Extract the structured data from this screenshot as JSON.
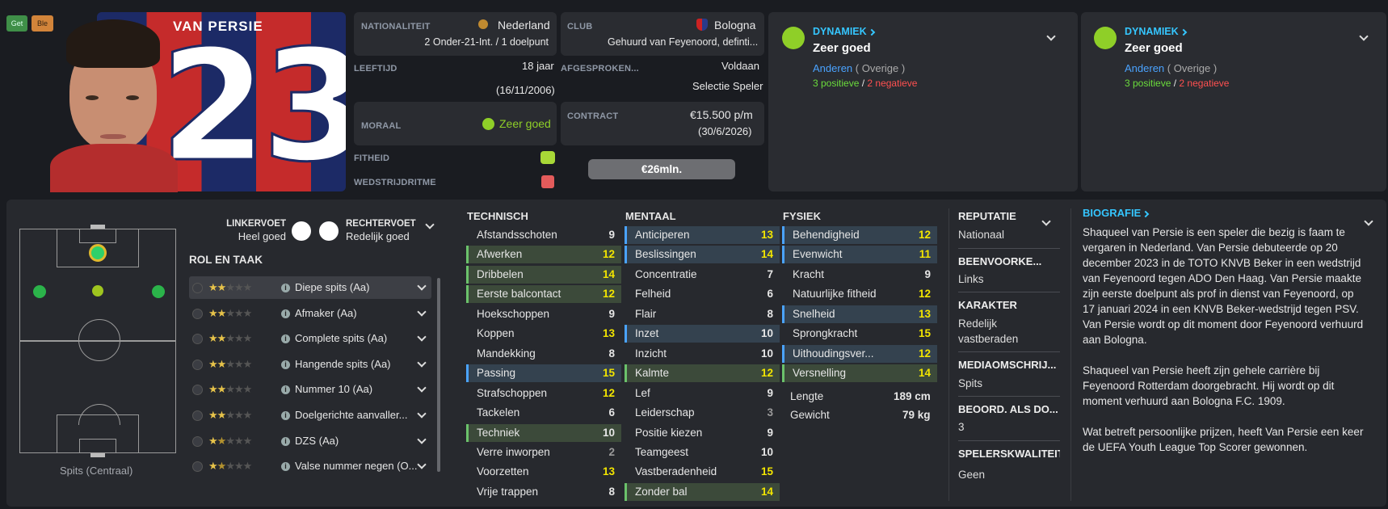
{
  "buttons": {
    "get": "Get",
    "ble": "Ble"
  },
  "player": {
    "name": "VAN PERSIE",
    "number": "23",
    "position": "Spits (Centraal)"
  },
  "info": {
    "nationaliteit_label": "NATIONALITEIT",
    "nationaliteit": "Nederland",
    "caps": "2 Onder-21-Int. / 1 doelpunt",
    "club_label": "CLUB",
    "club": "Bologna",
    "club_sub": "Gehuurd van Feyenoord, definti...",
    "leeftijd_label": "LEEFTIJD",
    "leeftijd": "18 jaar",
    "geboorte": "(16/11/2006)",
    "afgesproken_label": "AFGESPROKEN...",
    "afgesproken": "Voldaan",
    "selectie": "Selectie Speler",
    "moraal_label": "MORAAL",
    "moraal": "Zeer goed",
    "contract_label": "CONTRACT",
    "contract": "€15.500 p/m",
    "contract_end": "(30/6/2026)",
    "fitheid_label": "FITHEID",
    "wedstrijd_label": "WEDSTRIJDRITME",
    "waarde": "€26mln."
  },
  "dyn1": {
    "title": "DYNAMIEK",
    "value": "Zeer goed",
    "group": "Anderen",
    "group_sub": "( Overige )",
    "pos": "3 positieve",
    "sep": "/",
    "neg": "2 negatieve"
  },
  "dyn2": {
    "title": "DYNAMIEK",
    "value": "Zeer goed",
    "group": "Anderen",
    "group_sub": "( Overige )",
    "pos": "3 positieve",
    "sep": "/",
    "neg": "2 negatieve"
  },
  "feet": {
    "left_label": "LINKERVOET",
    "left": "Heel goed",
    "right_label": "RECHTERVOET",
    "right": "Redelijk goed"
  },
  "rol": {
    "title": "ROL EN TAAK",
    "items": [
      {
        "name": "Diepe spits (Aa)",
        "stars": 2
      },
      {
        "name": "Afmaker (Aa)",
        "stars": 2
      },
      {
        "name": "Complete spits (Aa)",
        "stars": 2
      },
      {
        "name": "Hangende spits (Aa)",
        "stars": 2
      },
      {
        "name": "Nummer 10 (Aa)",
        "stars": 2
      },
      {
        "name": "Doelgerichte aanvaller...",
        "stars": 2
      },
      {
        "name": "DZS (Aa)",
        "stars": 1.5
      },
      {
        "name": "Valse nummer negen (O...",
        "stars": 1.5
      }
    ]
  },
  "technisch": {
    "title": "TECHNISCH",
    "rows": [
      {
        "n": "Afstandsschoten",
        "v": "9",
        "h": ""
      },
      {
        "n": "Afwerken",
        "v": "12",
        "h": "g"
      },
      {
        "n": "Dribbelen",
        "v": "14",
        "h": "g"
      },
      {
        "n": "Eerste balcontact",
        "v": "12",
        "h": "g"
      },
      {
        "n": "Hoekschoppen",
        "v": "9",
        "h": ""
      },
      {
        "n": "Koppen",
        "v": "13",
        "h": ""
      },
      {
        "n": "Mandekking",
        "v": "8",
        "h": ""
      },
      {
        "n": "Passing",
        "v": "15",
        "h": "b"
      },
      {
        "n": "Strafschoppen",
        "v": "12",
        "h": ""
      },
      {
        "n": "Tackelen",
        "v": "6",
        "h": ""
      },
      {
        "n": "Techniek",
        "v": "10",
        "h": "g"
      },
      {
        "n": "Verre inworpen",
        "v": "2",
        "h": ""
      },
      {
        "n": "Voorzetten",
        "v": "13",
        "h": ""
      },
      {
        "n": "Vrije trappen",
        "v": "8",
        "h": ""
      }
    ]
  },
  "mentaal": {
    "title": "MENTAAL",
    "rows": [
      {
        "n": "Anticiperen",
        "v": "13",
        "h": "b"
      },
      {
        "n": "Beslissingen",
        "v": "14",
        "h": "b"
      },
      {
        "n": "Concentratie",
        "v": "7",
        "h": ""
      },
      {
        "n": "Felheid",
        "v": "6",
        "h": ""
      },
      {
        "n": "Flair",
        "v": "8",
        "h": ""
      },
      {
        "n": "Inzet",
        "v": "10",
        "h": "b"
      },
      {
        "n": "Inzicht",
        "v": "10",
        "h": ""
      },
      {
        "n": "Kalmte",
        "v": "12",
        "h": "g"
      },
      {
        "n": "Lef",
        "v": "9",
        "h": ""
      },
      {
        "n": "Leiderschap",
        "v": "3",
        "h": ""
      },
      {
        "n": "Positie kiezen",
        "v": "9",
        "h": ""
      },
      {
        "n": "Teamgeest",
        "v": "10",
        "h": ""
      },
      {
        "n": "Vastberadenheid",
        "v": "15",
        "h": ""
      },
      {
        "n": "Zonder bal",
        "v": "14",
        "h": "g"
      }
    ]
  },
  "fysiek": {
    "title": "FYSIEK",
    "rows": [
      {
        "n": "Behendigheid",
        "v": "12",
        "h": "b"
      },
      {
        "n": "Evenwicht",
        "v": "11",
        "h": "b"
      },
      {
        "n": "Kracht",
        "v": "9",
        "h": ""
      },
      {
        "n": "Natuurlijke fitheid",
        "v": "12",
        "h": ""
      },
      {
        "n": "Snelheid",
        "v": "13",
        "h": "b"
      },
      {
        "n": "Sprongkracht",
        "v": "15",
        "h": ""
      },
      {
        "n": "Uithoudingsver...",
        "v": "12",
        "h": "b"
      },
      {
        "n": "Versnelling",
        "v": "14",
        "h": "g"
      }
    ],
    "lengte_label": "Lengte",
    "lengte": "189 cm",
    "gewicht_label": "Gewicht",
    "gewicht": "79 kg"
  },
  "side": {
    "reputatie_label": "REPUTATIE",
    "reputatie": "Nationaal",
    "been_label": "BEENVOORKE...",
    "been": "Links",
    "karakter_label": "KARAKTER",
    "karakter1": "Redelijk",
    "karakter2": "vastberaden",
    "media_label": "MEDIAOMSCHRIJ...",
    "media": "Spits",
    "beoord_label": "BEOORD. ALS DO...",
    "beoord": "3",
    "kwal_label": "SPELERSKWALITEIT",
    "kwal": "Geen"
  },
  "bio": {
    "title": "BIOGRAFIE",
    "p1": [
      "Shaqueel van Persie is een speler die bezig is faam te",
      "vergaren in Nederland. Van Persie debuteerde op 20",
      "december 2023 in de TOTO KNVB Beker in een wedstrijd",
      "van Feyenoord tegen ADO Den Haag. Van Persie maakte",
      "zijn eerste doelpunt als prof in dienst van Feyenoord, op",
      "17 januari 2024 in een KNVB Beker-wedstrijd tegen PSV.",
      "Van Persie wordt op dit moment door Feyenoord verhuurd",
      "aan Bologna."
    ],
    "p2": [
      "Shaqueel van Persie heeft zijn gehele carrière bij",
      "Feyenoord Rotterdam doorgebracht. Hij wordt op dit",
      "moment verhuurd aan Bologna F.C. 1909."
    ],
    "p3": [
      "Wat betreft persoonlijke prijzen, heeft Van Persie een keer",
      "de UEFA Youth League Top Scorer gewonnen."
    ]
  },
  "colors": {
    "green": "#6bdc3c",
    "red": "#ff5050",
    "blue": "#4aa3ff",
    "cyan": "#35c6ff",
    "yellow": "#f2e500"
  }
}
